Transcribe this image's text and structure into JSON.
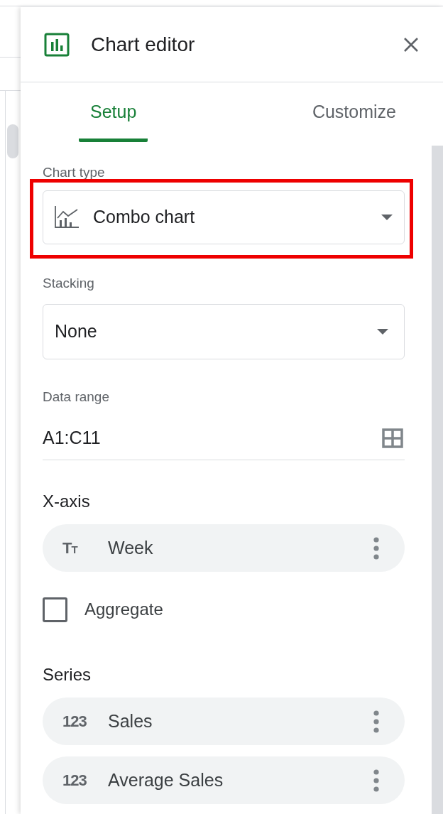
{
  "window": {
    "title": "Chart editor"
  },
  "tabs": [
    {
      "label": "Setup",
      "selected": true
    },
    {
      "label": "Customize",
      "selected": false
    }
  ],
  "chart_type": {
    "label": "Chart type",
    "value": "Combo chart",
    "highlighted": true
  },
  "stacking": {
    "label": "Stacking",
    "value": "None"
  },
  "data_range": {
    "label": "Data range",
    "value": "A1:C11"
  },
  "x_axis": {
    "heading": "X-axis",
    "chips": [
      {
        "type_glyph": "Tt",
        "label": "Week"
      }
    ]
  },
  "aggregate": {
    "label": "Aggregate",
    "checked": false
  },
  "series": {
    "heading": "Series",
    "chips": [
      {
        "type_glyph": "123",
        "label": "Sales"
      },
      {
        "type_glyph": "123",
        "label": "Average Sales"
      }
    ]
  }
}
